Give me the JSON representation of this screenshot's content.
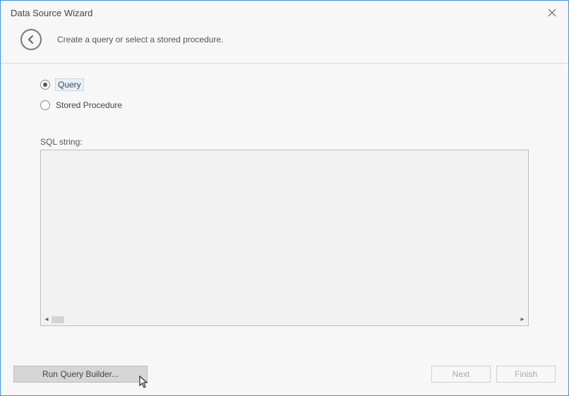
{
  "title": "Data Source Wizard",
  "header": {
    "instruction": "Create a query or select a stored procedure."
  },
  "options": {
    "query_label": "Query",
    "stored_procedure_label": "Stored Procedure",
    "selected": "query"
  },
  "sql": {
    "label": "SQL string:",
    "value": ""
  },
  "buttons": {
    "run_query_builder": "Run Query Builder...",
    "next": "Next",
    "finish": "Finish"
  }
}
